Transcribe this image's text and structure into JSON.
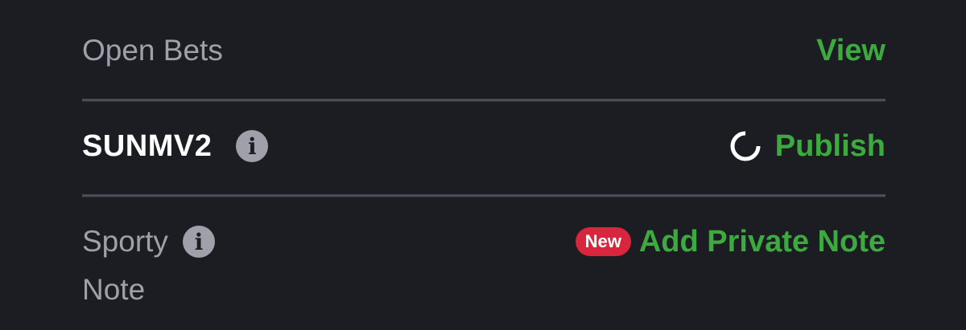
{
  "open_bets": {
    "label": "Open Bets",
    "action_label": "View"
  },
  "booking": {
    "code": "SUNMV2",
    "info_icon": "info-icon",
    "spinner_icon": "spinner-icon",
    "action_label": "Publish"
  },
  "note": {
    "label_line1": "Sporty",
    "label_line2": "Note",
    "info_icon": "info-icon",
    "badge": "New",
    "action_label": "Add Private Note"
  },
  "colors": {
    "background": "#1c1d22",
    "accent_green": "#3daa3f",
    "muted_text": "#9ea0aa",
    "badge_red": "#d7263d",
    "divider": "#4a4c58"
  }
}
